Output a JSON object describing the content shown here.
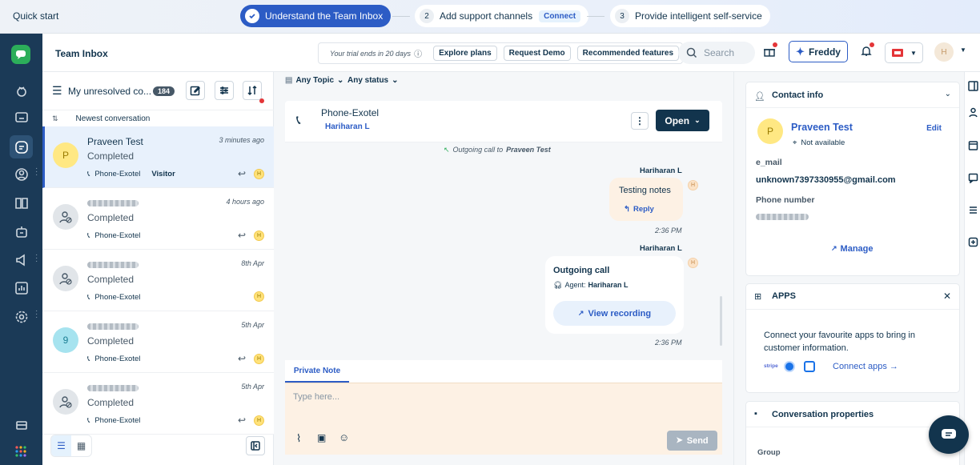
{
  "quickstart": {
    "title": "Quick start",
    "step1": {
      "num": "1",
      "label": "Understand the Team Inbox"
    },
    "step2": {
      "num": "2",
      "label": "Add support channels",
      "badge": "Connect"
    },
    "step3": {
      "num": "3",
      "label": "Provide intelligent self-service"
    }
  },
  "header": {
    "title": "Team Inbox",
    "trial": "Your trial ends in 20 days",
    "explore": "Explore plans",
    "demo": "Request Demo",
    "features": "Recommended features",
    "search_placeholder": "Search",
    "freddy": "Freddy",
    "avatar": "H"
  },
  "list": {
    "view": "My unresolved co...",
    "count": "184",
    "sort": "Newest conversation",
    "conversations": [
      {
        "name": "Praveen Test",
        "avatar": "P",
        "status": "Completed",
        "time": "3 minutes ago",
        "channel": "Phone-Exotel",
        "tag": "Visitor",
        "agent": "H"
      },
      {
        "name": "",
        "avatar": "",
        "status": "Completed",
        "time": "4 hours ago",
        "channel": "Phone-Exotel",
        "tag": "",
        "agent": "H"
      },
      {
        "name": "",
        "avatar": "",
        "status": "Completed",
        "time": "8th Apr",
        "channel": "Phone-Exotel",
        "tag": "",
        "agent": "H"
      },
      {
        "name": "",
        "avatar": "9",
        "status": "Completed",
        "time": "5th Apr",
        "channel": "Phone-Exotel",
        "tag": "",
        "agent": "H"
      },
      {
        "name": "",
        "avatar": "",
        "status": "Completed",
        "time": "5th Apr",
        "channel": "Phone-Exotel",
        "tag": "",
        "agent": "H"
      }
    ]
  },
  "chat": {
    "topic_filter": "Any Topic",
    "status_filter": "Any status",
    "channel": "Phone-Exotel",
    "assignee": "Hariharan L",
    "status_button": "Open",
    "system_msg": "Outgoing call to",
    "system_contact": "Praveen Test",
    "msg1": {
      "author": "Hariharan L",
      "text": "Testing notes",
      "reply": "Reply",
      "time": "2:36 PM"
    },
    "msg2": {
      "author": "Hariharan L",
      "title": "Outgoing call",
      "agent_label": "Agent:",
      "agent": "Hariharan L",
      "action": "View recording",
      "time": "2:36 PM"
    },
    "compose_tab": "Private Note",
    "compose_placeholder": "Type here...",
    "send": "Send"
  },
  "contact": {
    "section": "Contact info",
    "avatar": "P",
    "name": "Praveen Test",
    "edit": "Edit",
    "availability": "Not available",
    "email_label": "e_mail",
    "email": "unknown7397330955@gmail.com",
    "phone_label": "Phone number",
    "manage": "Manage"
  },
  "apps": {
    "section": "APPS",
    "text": "Connect your favourite apps to bring in customer information.",
    "stripe": "stripe",
    "connect": "Connect apps →"
  },
  "convprops": {
    "section": "Conversation properties",
    "group": "Group"
  },
  "colors": {
    "primary": "#2c5cc5",
    "navy": "#12344d",
    "nav_bg": "#1b3a57",
    "note_bg": "#fdf1e4"
  }
}
